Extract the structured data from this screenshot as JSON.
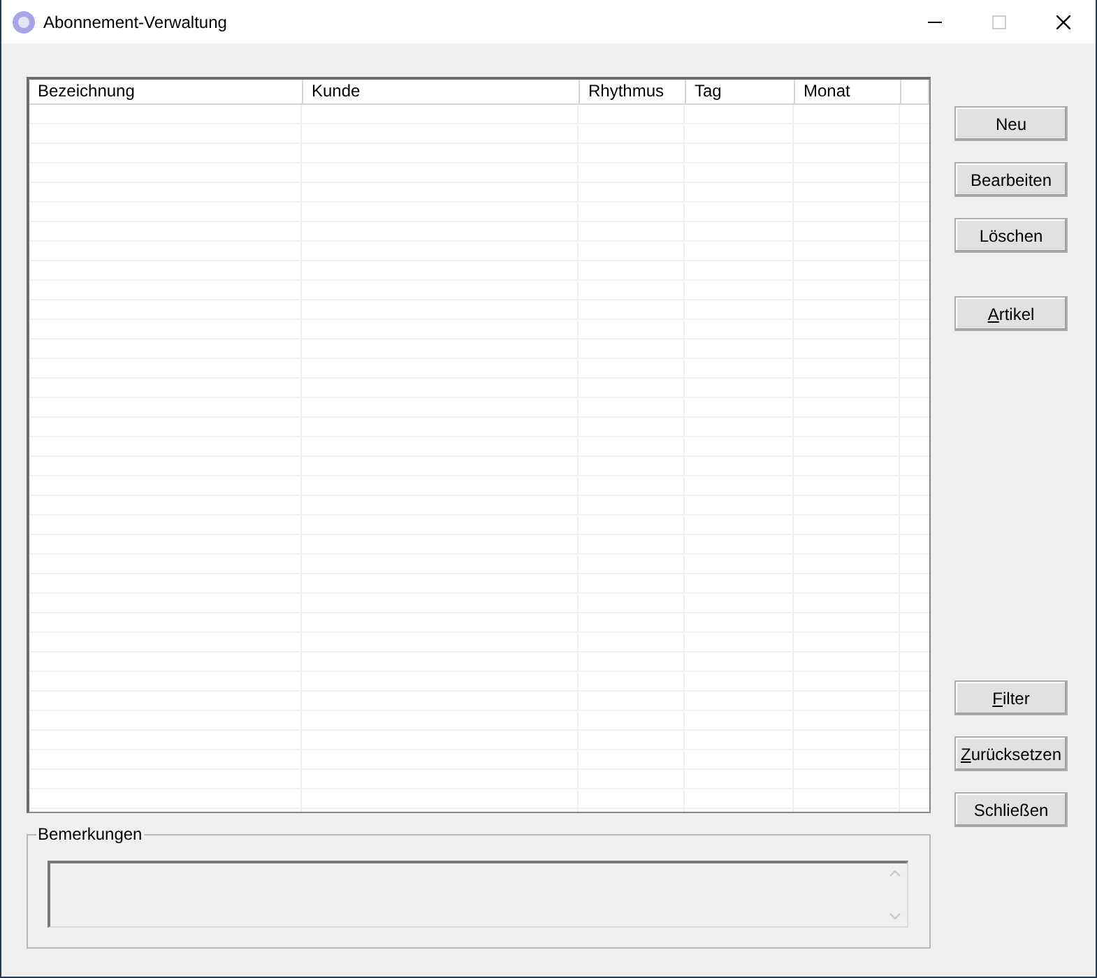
{
  "window": {
    "title": "Abonnement-Verwaltung"
  },
  "table": {
    "columns": [
      "Bezeichnung",
      "Kunde",
      "Rhythmus",
      "Tag",
      "Monat"
    ]
  },
  "buttons": [
    {
      "label": "Neu",
      "mnemonic": false
    },
    {
      "label": "Bearbeiten",
      "mnemonic": false
    },
    {
      "label": "Löschen",
      "mnemonic": false
    },
    {
      "label": "Artikel",
      "mnemonic": true
    },
    {
      "label": "Filter",
      "mnemonic": true
    },
    {
      "label": "Zurücksetzen",
      "mnemonic": true
    },
    {
      "label": "Schließen",
      "mnemonic": false
    }
  ],
  "remarks": {
    "label": "Bemerkungen",
    "disabled": true
  }
}
